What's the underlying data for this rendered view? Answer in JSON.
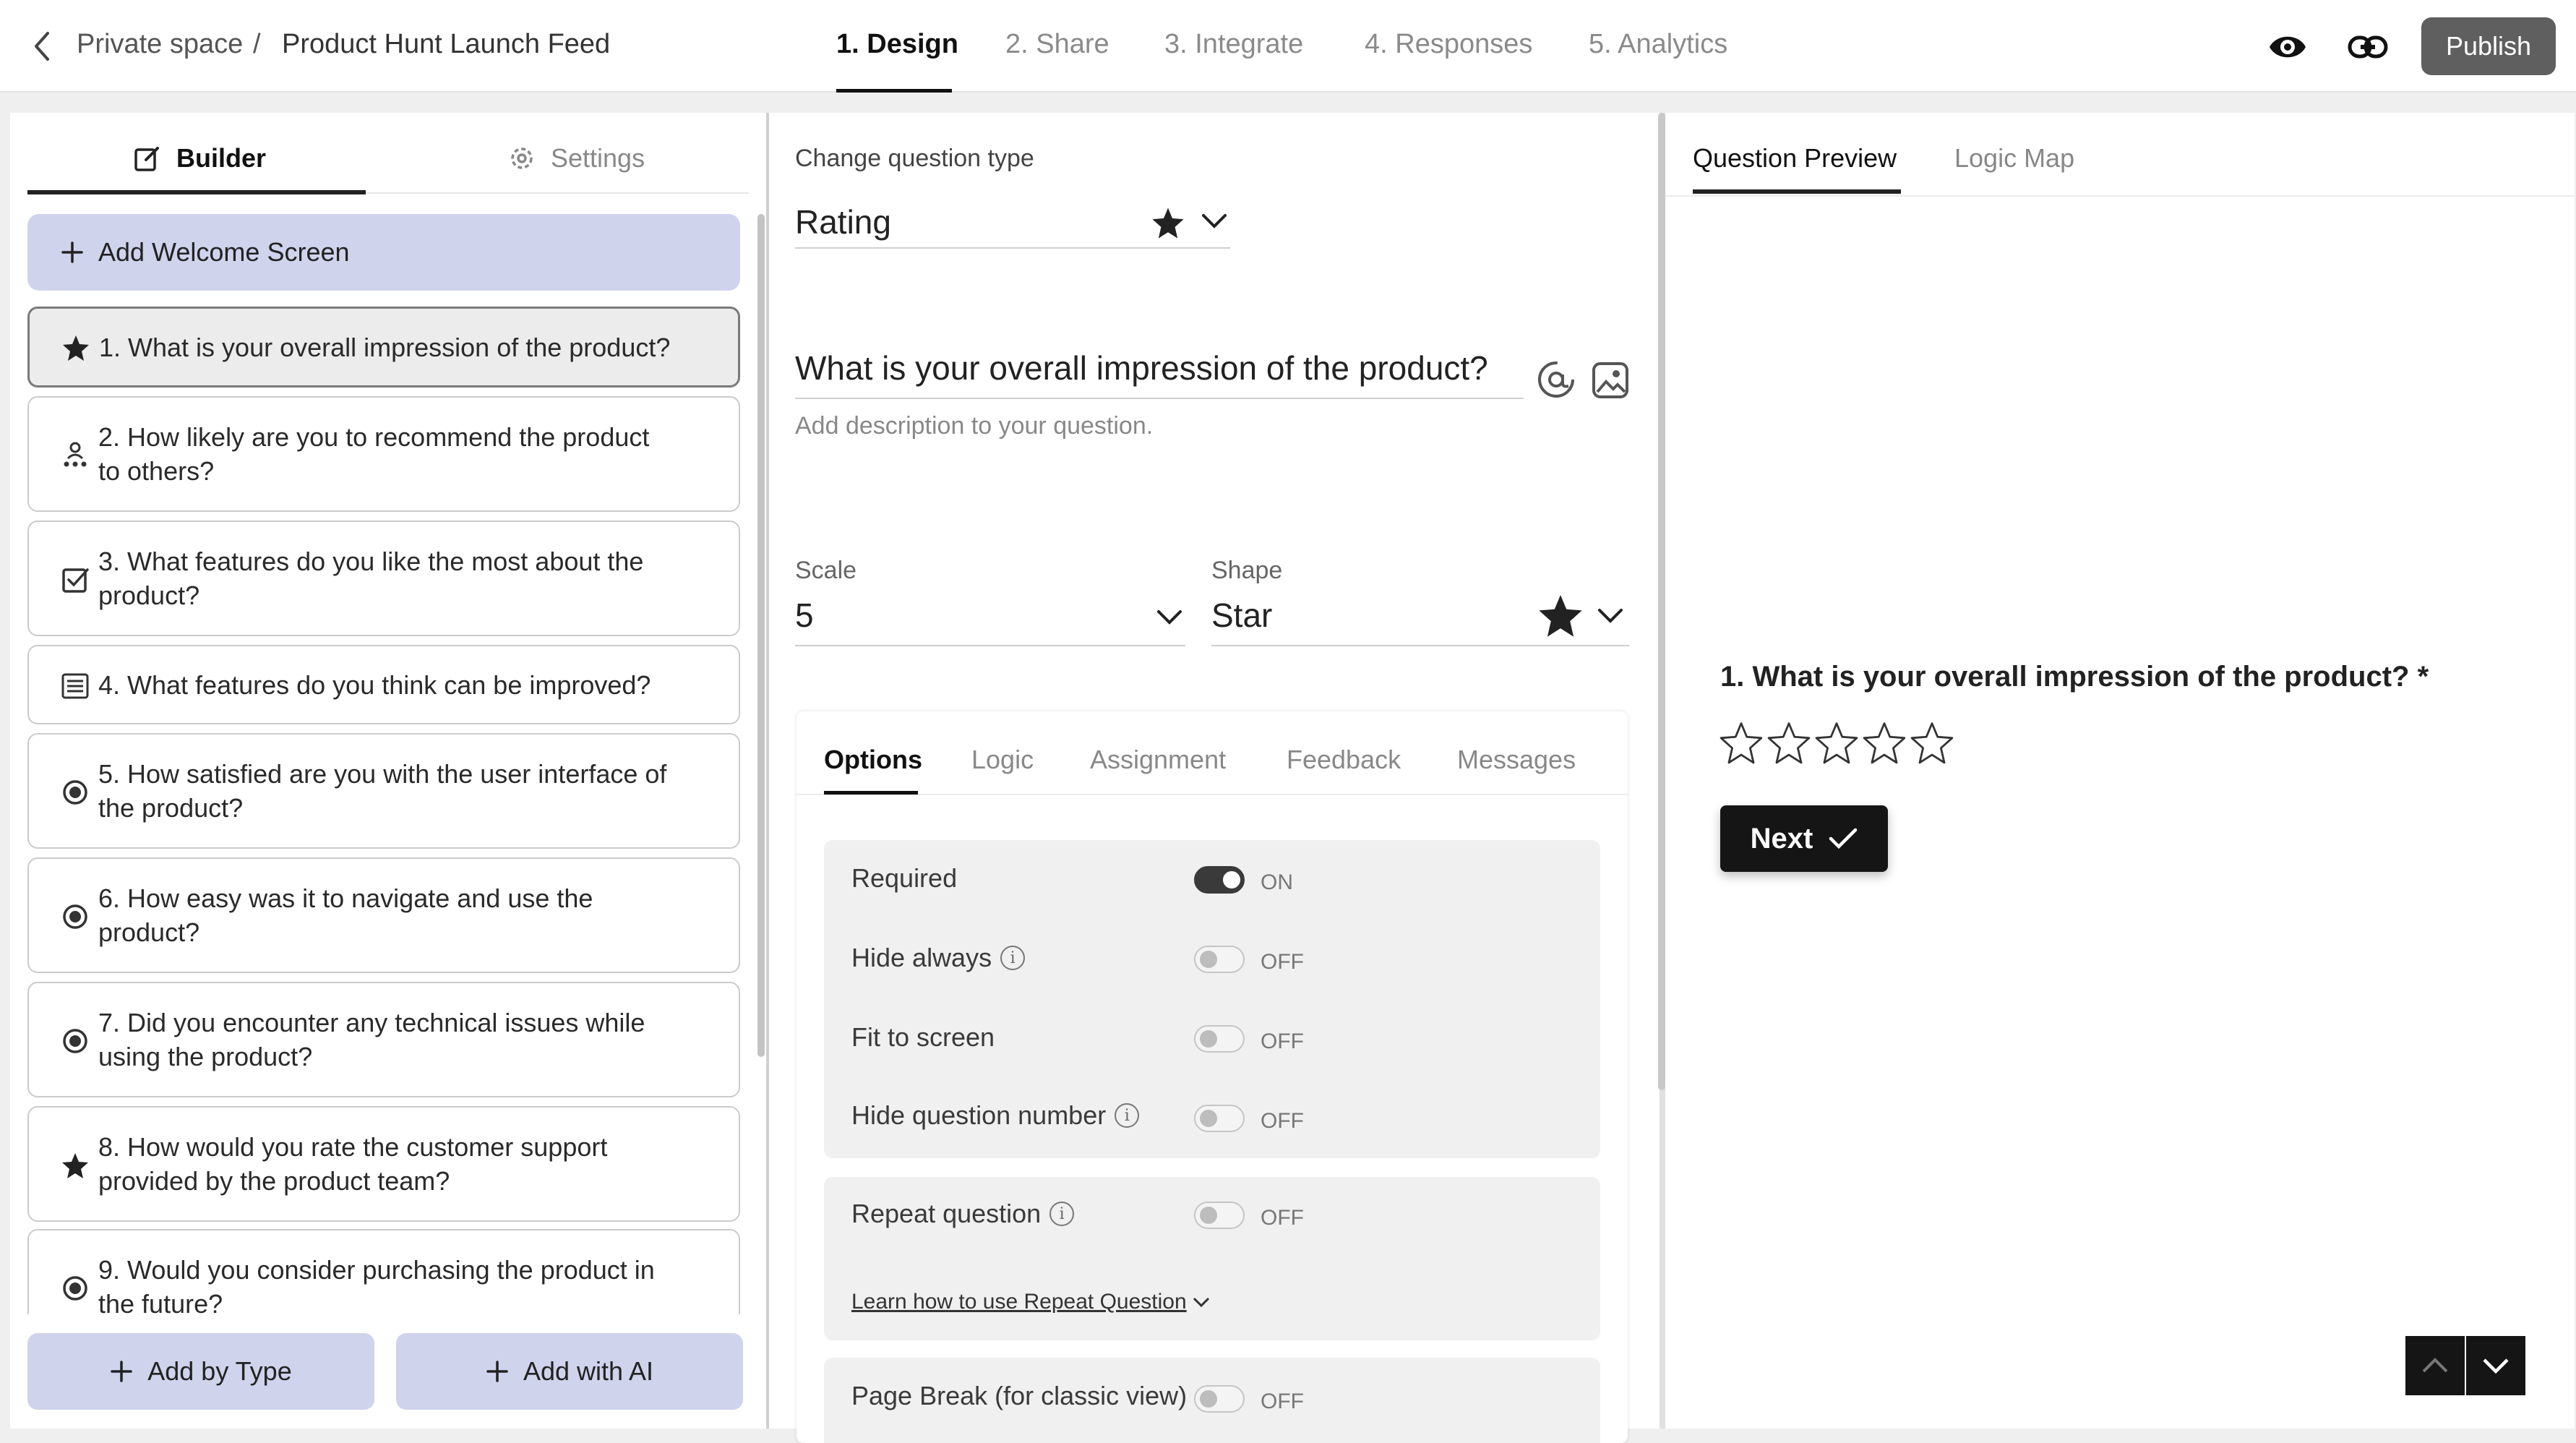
{
  "header": {
    "breadcrumb": {
      "space": "Private space",
      "separator": "/",
      "form": "Product Hunt Launch Feed"
    },
    "steps": [
      "1. Design",
      "2. Share",
      "3. Integrate",
      "4. Responses",
      "5. Analytics"
    ],
    "active_step": "1. Design",
    "publish_label": "Publish",
    "icons": [
      "back-chevron-icon",
      "eye-icon",
      "link-icon"
    ]
  },
  "left": {
    "tabs": {
      "builder": "Builder",
      "settings": "Settings"
    },
    "welcome_label": "Add Welcome Screen",
    "questions": [
      {
        "line1": "1. What is your overall impression of the product?",
        "line2": "",
        "icon": "star-icon",
        "selected": true
      },
      {
        "line1": "2. How likely are you to recommend the product",
        "line2": "to others?",
        "icon": "nps-people-icon"
      },
      {
        "line1": "3. What features do you like the most about the",
        "line2": "product?",
        "icon": "checkbox-icon"
      },
      {
        "line1": "4. What features do you think can be improved?",
        "line2": "",
        "icon": "long-text-icon"
      },
      {
        "line1": "5. How satisfied are you with the user interface of",
        "line2": "the product?",
        "icon": "radio-icon"
      },
      {
        "line1": "6. How easy was it to navigate and use the",
        "line2": "product?",
        "icon": "radio-icon"
      },
      {
        "line1": "7. Did you encounter any technical issues while",
        "line2": "using the product?",
        "icon": "radio-icon"
      },
      {
        "line1": "8. How would you rate the customer support",
        "line2": "provided by the product team?",
        "icon": "star-icon"
      },
      {
        "line1": "9. Would you consider purchasing the product in",
        "line2": "the future?",
        "icon": "radio-icon"
      }
    ],
    "add_by_type": "Add by Type",
    "add_with_ai": "Add with AI"
  },
  "middle": {
    "change_type_label": "Change question type",
    "question_type": "Rating",
    "question_text": "What is your overall impression of the product?",
    "description_placeholder": "Add description to your question.",
    "scale_label": "Scale",
    "scale_value": "5",
    "shape_label": "Shape",
    "shape_value": "Star",
    "option_tabs": [
      "Options",
      "Logic",
      "Assignment",
      "Feedback",
      "Messages"
    ],
    "options": {
      "required": {
        "label": "Required",
        "state": "ON"
      },
      "hide_always": {
        "label": "Hide always",
        "state": "OFF"
      },
      "fit_to_screen": {
        "label": "Fit to screen",
        "state": "OFF"
      },
      "hide_number": {
        "label": "Hide question number",
        "state": "OFF"
      },
      "repeat": {
        "label": "Repeat question",
        "state": "OFF"
      },
      "learn_link": "Learn how to use Repeat Question",
      "page_break": {
        "label": "Page Break (for classic view)",
        "state": "OFF"
      }
    }
  },
  "right": {
    "tabs": {
      "preview": "Question Preview",
      "logic_map": "Logic Map"
    },
    "preview_question": "1. What is your overall impression of the product? *",
    "star_count": 5,
    "next_label": "Next"
  },
  "colors": {
    "accent_light": "#cfd3ec",
    "dark": "#151515",
    "publish": "#5f5f5f"
  }
}
